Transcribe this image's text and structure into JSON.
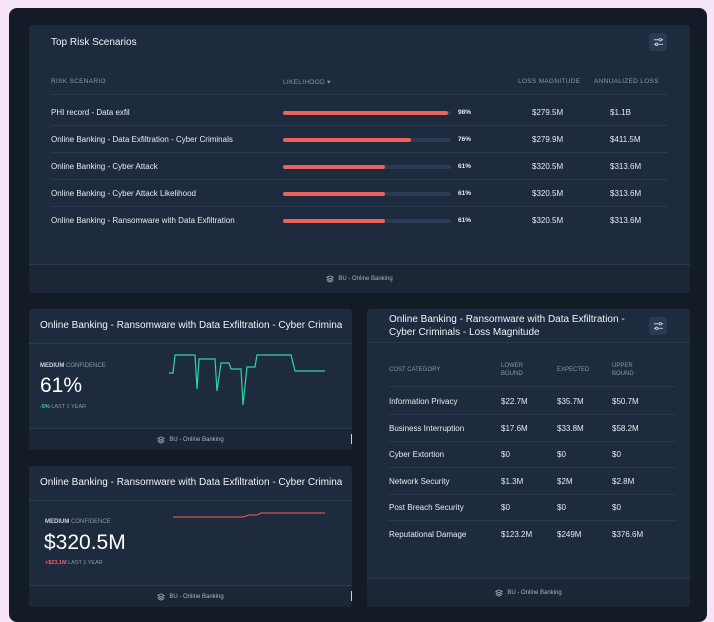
{
  "top_risk": {
    "title": "Top Risk Scenarios",
    "headers": {
      "scenario": "RISK SCENARIO",
      "likelihood": "LIKELIHOOD ▾",
      "loss_magnitude": "LOSS MAGNITUDE",
      "annualized_loss": "ANNUALIZED LOSS"
    },
    "rows": [
      {
        "scenario": "PHI record - Data exfil",
        "likelihood_label": "98%",
        "likelihood": 0.98,
        "loss_magnitude": "$279.5M",
        "annualized_loss": "$1.1B"
      },
      {
        "scenario": "Online Banking - Data Exfiltration - Cyber Criminals",
        "likelihood_label": "76%",
        "likelihood": 0.76,
        "loss_magnitude": "$279.9M",
        "annualized_loss": "$411.5M"
      },
      {
        "scenario": "Online Banking - Cyber Attack",
        "likelihood_label": "61%",
        "likelihood": 0.61,
        "loss_magnitude": "$320.5M",
        "annualized_loss": "$313.6M"
      },
      {
        "scenario": "Online Banking - Cyber Attack Likelihood",
        "likelihood_label": "61%",
        "likelihood": 0.61,
        "loss_magnitude": "$320.5M",
        "annualized_loss": "$313.6M"
      },
      {
        "scenario": "Online Banking - Ransomware with Data Exfiltration",
        "likelihood_label": "61%",
        "likelihood": 0.61,
        "loss_magnitude": "$320.5M",
        "annualized_loss": "$313.6M"
      }
    ],
    "footer": "BU - Online Banking"
  },
  "metric_likelihood": {
    "title": "Online Banking - Ransomware with Data Exfiltration - Cyber Criminals",
    "confidence_level": "MEDIUM",
    "confidence_word": "CONFIDENCE",
    "value": "61%",
    "delta": "-5%",
    "delta_period": "LAST 1 YEAR",
    "footer": "BU - Online Banking",
    "spark_color": "#2fd6a1"
  },
  "metric_loss": {
    "title": "Online Banking - Ransomware with Data Exfiltration - Cyber Criminals",
    "confidence_level": "MEDIUM",
    "confidence_word": "CONFIDENCE",
    "value": "$320.5M",
    "delta": "+$23.1M",
    "delta_period": "LAST 1 YEAR",
    "footer": "BU - Online Banking",
    "spark_color": "#f0605e"
  },
  "loss_table": {
    "title": "Online Banking - Ransomware with Data Exfiltration - Cyber Criminals - Loss Magnitude",
    "headers": {
      "category": "COST CATEGORY",
      "lower": "LOWER BOUND",
      "expected": "EXPECTED",
      "upper": "UPPER BOUND"
    },
    "rows": [
      {
        "category": "Information Privacy",
        "lower": "$22.7M",
        "expected": "$35.7M",
        "upper": "$50.7M"
      },
      {
        "category": "Business Interruption",
        "lower": "$17.6M",
        "expected": "$33.8M",
        "upper": "$58.2M"
      },
      {
        "category": "Cyber Extortion",
        "lower": "$0",
        "expected": "$0",
        "upper": "$0"
      },
      {
        "category": "Network Security",
        "lower": "$1.3M",
        "expected": "$2M",
        "upper": "$2.8M"
      },
      {
        "category": "Post Breach Security",
        "lower": "$0",
        "expected": "$0",
        "upper": "$0"
      },
      {
        "category": "Reputational Damage",
        "lower": "$123.2M",
        "expected": "$249M",
        "upper": "$376.6M"
      }
    ],
    "footer": "BU - Online Banking"
  },
  "colors": {
    "accent_red": "#f0605e",
    "accent_green": "#2fd6a1",
    "card_bg": "#1e2a3d"
  }
}
